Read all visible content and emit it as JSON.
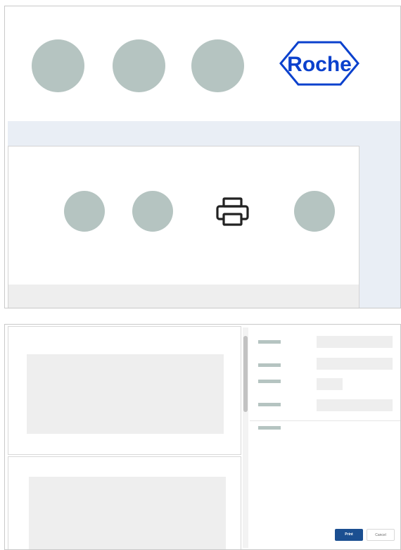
{
  "header": {
    "logo_text": "Roche",
    "brand_color": "#0b41cd"
  },
  "toolbar": {
    "icon": "printer-icon"
  },
  "dialog": {
    "print_label": "Print",
    "cancel_label": "Cancel"
  },
  "colors": {
    "placeholder_circle": "#b5c4c1",
    "primary_button": "#1b4f91",
    "band": "#e9eef5"
  }
}
